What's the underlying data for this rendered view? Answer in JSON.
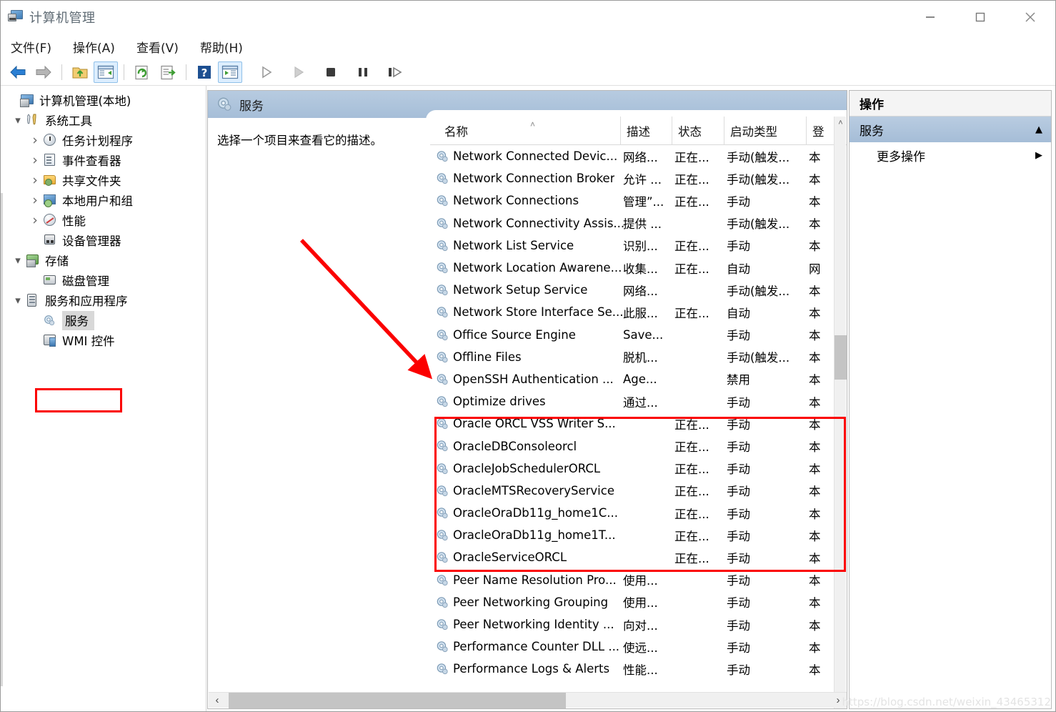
{
  "window": {
    "title": "计算机管理",
    "icon": "computer-management-icon",
    "controls": {
      "minimize": "—",
      "maximize": "□",
      "close": "✕"
    }
  },
  "menubar": {
    "items": [
      {
        "label": "文件(F)",
        "name": "menu-file"
      },
      {
        "label": "操作(A)",
        "name": "menu-action"
      },
      {
        "label": "查看(V)",
        "name": "menu-view"
      },
      {
        "label": "帮助(H)",
        "name": "menu-help"
      }
    ]
  },
  "toolbar": {
    "buttons": [
      {
        "name": "back-icon",
        "glyph": "back"
      },
      {
        "name": "forward-icon",
        "glyph": "forward"
      },
      {
        "name": "up-folder-icon",
        "glyph": "upfolder"
      },
      {
        "name": "show-hide-tree-icon",
        "glyph": "treepane",
        "active": true
      },
      {
        "name": "refresh-icon",
        "glyph": "refresh"
      },
      {
        "name": "export-list-icon",
        "glyph": "export"
      },
      {
        "name": "help-icon",
        "glyph": "help"
      },
      {
        "name": "properties-icon",
        "glyph": "properties",
        "active": true
      },
      {
        "name": "start-service-icon",
        "glyph": "play"
      },
      {
        "name": "resume-service-icon",
        "glyph": "play2"
      },
      {
        "name": "stop-service-icon",
        "glyph": "stop"
      },
      {
        "name": "pause-service-icon",
        "glyph": "pause"
      },
      {
        "name": "restart-service-icon",
        "glyph": "restart"
      }
    ]
  },
  "tree": {
    "root": {
      "label": "计算机管理(本地)",
      "icon": "computer-icon"
    },
    "items": [
      {
        "label": "系统工具",
        "icon": "tools-icon",
        "indent": 1,
        "toggle": "down"
      },
      {
        "label": "任务计划程序",
        "icon": "clock-icon",
        "indent": 2,
        "toggle": "right"
      },
      {
        "label": "事件查看器",
        "icon": "event-viewer-icon",
        "indent": 2,
        "toggle": "right"
      },
      {
        "label": "共享文件夹",
        "icon": "shared-folder-icon",
        "indent": 2,
        "toggle": "right"
      },
      {
        "label": "本地用户和组",
        "icon": "local-users-icon",
        "indent": 2,
        "toggle": "right"
      },
      {
        "label": "性能",
        "icon": "performance-icon",
        "indent": 2,
        "toggle": "right"
      },
      {
        "label": "设备管理器",
        "icon": "device-manager-icon",
        "indent": 2,
        "toggle": "none"
      },
      {
        "label": "存储",
        "icon": "storage-icon",
        "indent": 1,
        "toggle": "down"
      },
      {
        "label": "磁盘管理",
        "icon": "disk-management-icon",
        "indent": 2,
        "toggle": "none"
      },
      {
        "label": "服务和应用程序",
        "icon": "services-apps-icon",
        "indent": 1,
        "toggle": "down"
      },
      {
        "label": "服务",
        "icon": "service-gear-icon",
        "indent": 2,
        "toggle": "none",
        "selected": true
      },
      {
        "label": "WMI 控件",
        "icon": "wmi-control-icon",
        "indent": 2,
        "toggle": "none"
      }
    ]
  },
  "center": {
    "header_title": "服务",
    "header_icon": "service-gear-icon",
    "description_placeholder": "选择一个项目来查看它的描述。"
  },
  "list": {
    "columns": [
      {
        "label": "名称",
        "name": "column-name"
      },
      {
        "label": "描述",
        "name": "column-description"
      },
      {
        "label": "状态",
        "name": "column-status"
      },
      {
        "label": "启动类型",
        "name": "column-startup-type"
      },
      {
        "label": "登",
        "name": "column-logon-as"
      }
    ],
    "sort_indicator": "˄",
    "sort_column": "名称",
    "sort_direction": "ascending",
    "rows": [
      {
        "name": "Network Connected Devic...",
        "desc": "网络...",
        "status": "正在...",
        "startup": "手动(触发...",
        "logon": "本",
        "highlighted": false
      },
      {
        "name": "Network Connection Broker",
        "desc": "允许 ...",
        "status": "正在...",
        "startup": "手动(触发...",
        "logon": "本",
        "highlighted": false
      },
      {
        "name": "Network Connections",
        "desc": "管理”...",
        "status": "正在...",
        "startup": "手动",
        "logon": "本",
        "highlighted": false
      },
      {
        "name": "Network Connectivity Assis...",
        "desc": "提供 ...",
        "status": "",
        "startup": "手动(触发...",
        "logon": "本",
        "highlighted": false
      },
      {
        "name": "Network List Service",
        "desc": "识别...",
        "status": "正在...",
        "startup": "手动",
        "logon": "本",
        "highlighted": false
      },
      {
        "name": "Network Location Awarene...",
        "desc": "收集...",
        "status": "正在...",
        "startup": "自动",
        "logon": "网",
        "highlighted": false
      },
      {
        "name": "Network Setup Service",
        "desc": "网络...",
        "status": "",
        "startup": "手动(触发...",
        "logon": "本",
        "highlighted": false
      },
      {
        "name": "Network Store Interface Se...",
        "desc": "此服...",
        "status": "正在...",
        "startup": "自动",
        "logon": "本",
        "highlighted": false
      },
      {
        "name": "Office  Source Engine",
        "desc": "Save...",
        "status": "",
        "startup": "手动",
        "logon": "本",
        "highlighted": false
      },
      {
        "name": "Offline Files",
        "desc": "脱机...",
        "status": "",
        "startup": "手动(触发...",
        "logon": "本",
        "highlighted": false
      },
      {
        "name": "OpenSSH Authentication ...",
        "desc": "Age...",
        "status": "",
        "startup": "禁用",
        "logon": "本",
        "highlighted": false
      },
      {
        "name": "Optimize drives",
        "desc": "通过...",
        "status": "",
        "startup": "手动",
        "logon": "本",
        "highlighted": false
      },
      {
        "name": "Oracle ORCL VSS Writer S...",
        "desc": "",
        "status": "正在...",
        "startup": "手动",
        "logon": "本",
        "highlighted": true
      },
      {
        "name": "OracleDBConsoleorcl",
        "desc": "",
        "status": "正在...",
        "startup": "手动",
        "logon": "本",
        "highlighted": true
      },
      {
        "name": "OracleJobSchedulerORCL",
        "desc": "",
        "status": "正在...",
        "startup": "手动",
        "logon": "本",
        "highlighted": true
      },
      {
        "name": "OracleMTSRecoveryService",
        "desc": "",
        "status": "正在...",
        "startup": "手动",
        "logon": "本",
        "highlighted": true
      },
      {
        "name": "OracleOraDb11g_home1C...",
        "desc": "",
        "status": "正在...",
        "startup": "手动",
        "logon": "本",
        "highlighted": true
      },
      {
        "name": "OracleOraDb11g_home1T...",
        "desc": "",
        "status": "正在...",
        "startup": "手动",
        "logon": "本",
        "highlighted": true
      },
      {
        "name": "OracleServiceORCL",
        "desc": "",
        "status": "正在...",
        "startup": "手动",
        "logon": "本",
        "highlighted": true
      },
      {
        "name": "Peer Name Resolution Pro...",
        "desc": "使用...",
        "status": "",
        "startup": "手动",
        "logon": "本",
        "highlighted": false
      },
      {
        "name": "Peer Networking Grouping",
        "desc": "使用...",
        "status": "",
        "startup": "手动",
        "logon": "本",
        "highlighted": false
      },
      {
        "name": "Peer Networking Identity ...",
        "desc": "向对...",
        "status": "",
        "startup": "手动",
        "logon": "本",
        "highlighted": false
      },
      {
        "name": "Performance Counter DLL ...",
        "desc": "使远...",
        "status": "",
        "startup": "手动",
        "logon": "本",
        "highlighted": false
      },
      {
        "name": "Performance Logs & Alerts",
        "desc": "性能...",
        "status": "",
        "startup": "手动",
        "logon": "本",
        "highlighted": false
      }
    ]
  },
  "actions": {
    "title": "操作",
    "group_label": "服务",
    "collapse_glyph": "▲",
    "items": [
      {
        "label": "更多操作",
        "glyph": "▶",
        "name": "more-actions-item"
      }
    ]
  },
  "scrollbars": {
    "v_up": "˄",
    "v_down": "˅",
    "h_left": "‹",
    "h_right": "›"
  },
  "annotations": {
    "tree_box_color": "#fb0000",
    "list_box_color": "#fb0000",
    "arrow_color": "#fb0000"
  },
  "watermark": {
    "text": "https://blog.csdn.net/weixin_43465312"
  }
}
